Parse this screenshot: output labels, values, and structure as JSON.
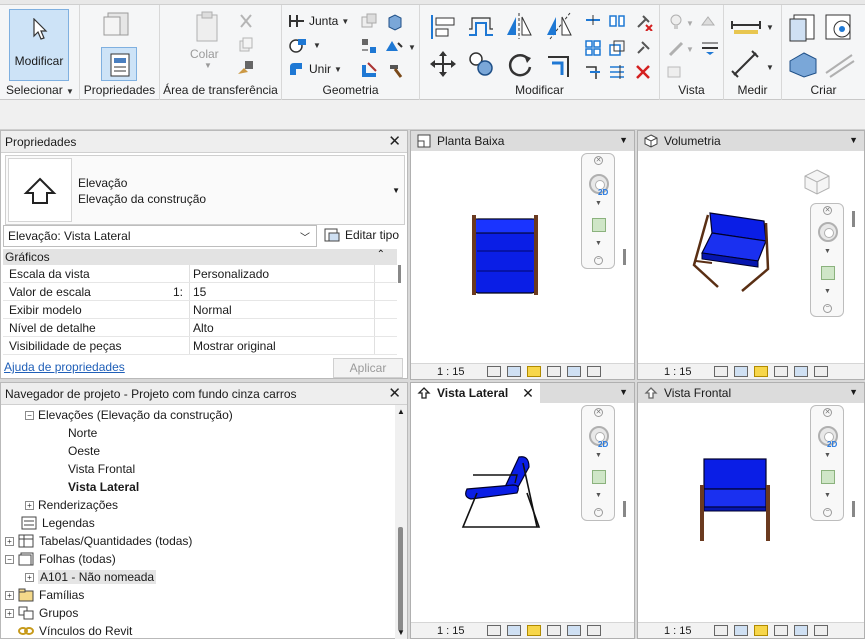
{
  "ribbon": {
    "select_panel": {
      "button": "Modificar",
      "label": "Selecionar"
    },
    "properties_panel": {
      "label": "Propriedades"
    },
    "clipboard_panel": {
      "paste": "Colar",
      "label": "Área de transferência"
    },
    "geometry_panel": {
      "join": "Junta",
      "union": "Unir",
      "label": "Geometria"
    },
    "modify_panel": {
      "label": "Modificar"
    },
    "view_panel": {
      "label": "Vista"
    },
    "measure_panel": {
      "label": "Medir"
    },
    "create_panel": {
      "label": "Criar"
    }
  },
  "properties": {
    "title": "Propriedades",
    "type_family": "Elevação",
    "type_name": "Elevação da construção",
    "selector": "Elevação: Vista Lateral",
    "edit_type": "Editar tipo",
    "category": "Gráficos",
    "rows": [
      {
        "name": "Escala da vista",
        "value": "Personalizado"
      },
      {
        "name": "Valor de escala",
        "suffix": "1:",
        "value": "15"
      },
      {
        "name": "Exibir modelo",
        "value": "Normal"
      },
      {
        "name": "Nível de detalhe",
        "value": "Alto"
      },
      {
        "name": "Visibilidade de peças",
        "value": "Mostrar original"
      }
    ],
    "help_link": "Ajuda de propriedades",
    "apply": "Aplicar"
  },
  "browser": {
    "title": "Navegador de projeto - Projeto com fundo cinza carros",
    "items": [
      {
        "label": "Elevações (Elevação da construção)",
        "toggle": "−"
      },
      {
        "label": "Norte"
      },
      {
        "label": "Oeste"
      },
      {
        "label": "Vista Frontal"
      },
      {
        "label": "Vista Lateral"
      },
      {
        "label": "Renderizações",
        "toggle": "+"
      },
      {
        "label": "Legendas"
      },
      {
        "label": "Tabelas/Quantidades (todas)",
        "toggle": "+"
      },
      {
        "label": "Folhas (todas)",
        "toggle": "−"
      },
      {
        "label": "A101 - Não nomeada",
        "toggle": "+"
      },
      {
        "label": "Famílias",
        "toggle": "+"
      },
      {
        "label": "Grupos",
        "toggle": "+"
      },
      {
        "label": "Vínculos do Revit",
        "toggle": ""
      }
    ]
  },
  "views": {
    "plan": {
      "title": "Planta Baixa",
      "scale": "1 : 15",
      "nav_label": "2D"
    },
    "iso": {
      "title": "Volumetria",
      "scale": "1 : 15"
    },
    "side": {
      "title": "Vista Lateral",
      "scale": "1 : 15",
      "nav_label": "2D",
      "close": "✕"
    },
    "front": {
      "title": "Vista Frontal",
      "scale": "1 : 15",
      "nav_label": "2D"
    }
  },
  "colors": {
    "chair_blue": "#0a1ee6",
    "frame_brown": "#6b3a1f",
    "accent_blue": "#cde3f7"
  }
}
